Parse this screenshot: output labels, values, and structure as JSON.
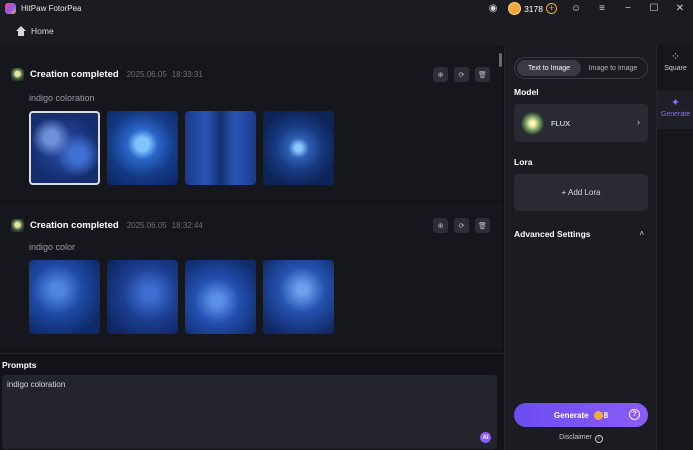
{
  "app": {
    "title": "HitPaw FotorPea",
    "credits": "3178",
    "accent": "#8b5cf6"
  },
  "nav": {
    "home_label": "Home"
  },
  "feed": {
    "cards": [
      {
        "status": "Creation completed",
        "date": "2025.06.05",
        "time": "18:33:31",
        "prompt": "indigo coloration"
      },
      {
        "status": "Creation completed",
        "date": "2025.06.05",
        "time": "18:32:44",
        "prompt": "indigo color"
      }
    ]
  },
  "prompts": {
    "label": "Prompts",
    "value": "indigo coloration",
    "ai_badge": "AI"
  },
  "settings": {
    "modes": [
      "Text to Image",
      "Image to Image"
    ],
    "model_label": "Model",
    "model_name": "FLUX",
    "lora_label": "Lora",
    "add_lora": "+ Add Lora",
    "advanced_label": "Advanced Settings",
    "generate_label": "Generate",
    "generate_cost": "8",
    "disclaimer": "Disclaimer"
  },
  "rail": {
    "square_label": "Square",
    "generate_label": "Generate"
  }
}
